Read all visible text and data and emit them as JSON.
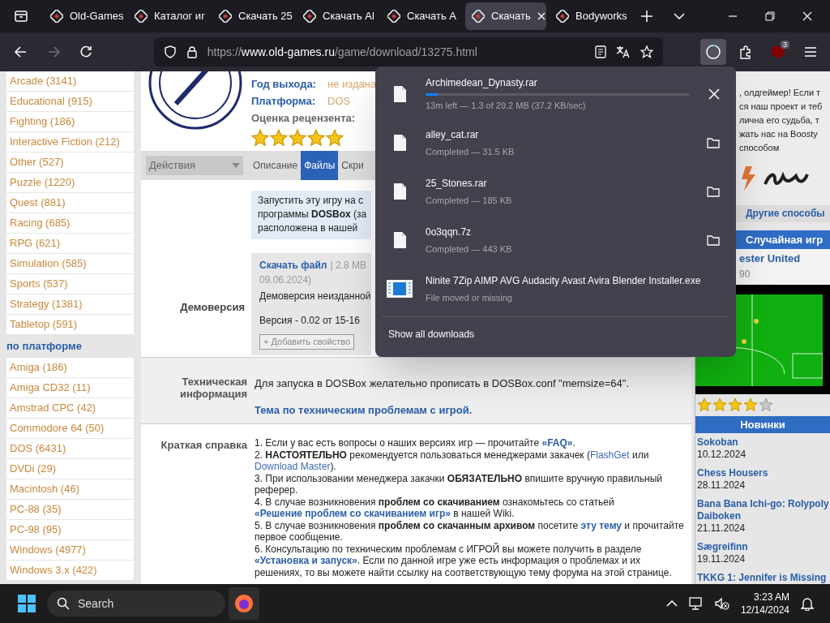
{
  "browser_tabs": [
    {
      "title": "Old-Games",
      "selected": false
    },
    {
      "title": "Каталог иг",
      "selected": false
    },
    {
      "title": "Скачать 25",
      "selected": false
    },
    {
      "title": "Скачать Al",
      "selected": false
    },
    {
      "title": "Скачать A",
      "selected": false
    },
    {
      "title": "Скачать",
      "selected": true
    },
    {
      "title": "Bodyworks",
      "selected": false
    }
  ],
  "nav_buttons": [
    {
      "kind": "back",
      "disabled": false
    },
    {
      "kind": "forward",
      "disabled": true
    },
    {
      "kind": "reload",
      "disabled": false
    }
  ],
  "address_bar": {
    "url_host": "https://www.old-games.ru",
    "url_path": "/game/download/13275.html"
  },
  "extension_badge": "3",
  "sidebar": {
    "genres": [
      "Arcade (3141)",
      "Educational (915)",
      "Fighting (186)",
      "Interactive Fiction (212)",
      "Other (527)",
      "Puzzle (1220)",
      "Quest (881)",
      "Racing (685)",
      "RPG (621)",
      "Simulation (585)",
      "Sports (537)",
      "Strategy (1381)",
      "Tabletop (591)"
    ],
    "platform_heading": "по платформе",
    "platforms": [
      "Amiga (186)",
      "Amiga CD32 (11)",
      "Amstrad CPC (42)",
      "Commodore 64 (50)",
      "DOS (6431)",
      "DVDi (29)",
      "Macintosh (46)",
      "PC-88 (35)",
      "PC-98 (95)",
      "Windows (4977)",
      "Windows 3.x (422)"
    ]
  },
  "game_info": {
    "fields": [
      {
        "label": "Год выхода:",
        "value": "не издана"
      },
      {
        "label": "Платформа:",
        "value": "DOS"
      }
    ],
    "rating_label": "Оценка рецензента:",
    "stars": 5
  },
  "page_tabs": {
    "actions": "Действия",
    "tabs": [
      {
        "label": "Описание",
        "selected": false
      },
      {
        "label": "Файлы",
        "selected": true
      },
      {
        "label": "Скри",
        "selected": false
      }
    ]
  },
  "notice_lines": [
    "Запустить эту игру на с",
    "программы **DOSBox** (за",
    "расположена в нашей"
  ],
  "file": {
    "label": "Демоверсия",
    "link": "Скачать файл",
    "size": "| 2.8 MB",
    "date": "09.06.2024)",
    "description": "Демоверсия неизданной",
    "version": "Версия - 0.02 от 15-16",
    "add_button": "+ Добавить свойство"
  },
  "tech": {
    "label": "Техническая информация",
    "text": "Для запуска в DOSBox желательно прописать в DOSBox.conf \"memsize=64\".",
    "link": "Тема по техническим проблемам с игрой."
  },
  "brief": {
    "label": "Краткая справка",
    "items": [
      [
        {
          "kind": "text",
          "t": "1. Если у вас есть вопросы о наших версиях игр — прочитайте "
        },
        {
          "kind": "link",
          "t": "«FAQ»"
        },
        {
          "kind": "text",
          "t": "."
        }
      ],
      [
        {
          "kind": "text",
          "t": "2. **НАСТОЯТЕЛЬНО** рекомендуется пользоваться менеджерами закачек ("
        },
        {
          "kind": "plainlink",
          "t": "FlashGet"
        },
        {
          "kind": "text",
          "t": " или "
        },
        {
          "kind": "plainlink",
          "t": "Download Master"
        },
        {
          "kind": "text",
          "t": ")."
        }
      ],
      [
        {
          "kind": "text",
          "t": "3. При использовании менеджера закачки **ОБЯЗАТЕЛЬНО** впишите вручную правильный реферер."
        }
      ],
      [
        {
          "kind": "text",
          "t": "4. В случае возникновения **проблем со скачиванием** ознакомьтесь со статьей "
        },
        {
          "kind": "link",
          "t": "«Решение проблем со скачиванием игр»"
        },
        {
          "kind": "text",
          "t": " в нашей Wiki."
        }
      ],
      [
        {
          "kind": "text",
          "t": "5. В случае возникновения **проблем со скачанным архивом** посетите "
        },
        {
          "kind": "link",
          "t": "эту тему"
        },
        {
          "kind": "text",
          "t": " и прочитайте первое сообщение."
        }
      ],
      [
        {
          "kind": "text",
          "t": "6. Консультацию по техническим проблемам с ИГРОЙ вы можете получить в разделе "
        },
        {
          "kind": "link",
          "t": "«Установка и запуск»"
        },
        {
          "kind": "text",
          "t": ". Если по данной игре уже есть информация о проблемах и их решениях, то вы можете найти ссылку на соответствующую тему форума на этой странице."
        }
      ]
    ]
  },
  "right": {
    "support_lines": [
      ", олдгеймер! Если т",
      "ся наш проект и теб",
      "лична его судьба, т",
      "жать нас на Boosty",
      "способом"
    ],
    "other_ways": "Другие способы",
    "random_heading": "Случайная игр",
    "random_game": {
      "title": "ester United",
      "year": "90",
      "stars": 4
    },
    "news_heading": "Новинки",
    "news": [
      {
        "title": "Sokoban",
        "date": "10.12.2024"
      },
      {
        "title": "Chess Housers",
        "date": "28.11.2024"
      },
      {
        "title": "Bana Bana Ichi-go: Rolypoly Daiboken",
        "date": "21.11.2024"
      },
      {
        "title": "Sægreifinn",
        "date": "19.11.2024"
      },
      {
        "title": "TKKG 1: Jennifer is Missing"
      }
    ]
  },
  "downloads": {
    "items": [
      {
        "kind": "progress",
        "name": "Archimedean_Dynasty.rar",
        "status": "13m left — 1.3 of 29.2 MB (37.2 KB/sec)",
        "level": 0.045
      },
      {
        "kind": "completed",
        "name": "alley_cat.rar",
        "status": "Completed — 31.5 KB"
      },
      {
        "kind": "completed",
        "name": "25_Stones.rar",
        "status": "Completed — 185 KB"
      },
      {
        "kind": "completed",
        "name": "0o3qqn.7z",
        "status": "Completed — 443 KB"
      },
      {
        "kind": "missing",
        "name": "Ninite 7Zip AIMP AVG Audacity Avast Avira Blender Installer.exe",
        "status": "File moved or missing"
      }
    ],
    "show_all": "Show all downloads"
  },
  "taskbar": {
    "search_placeholder": "Search",
    "time": "3:23 AM",
    "date": "12/14/2024"
  }
}
